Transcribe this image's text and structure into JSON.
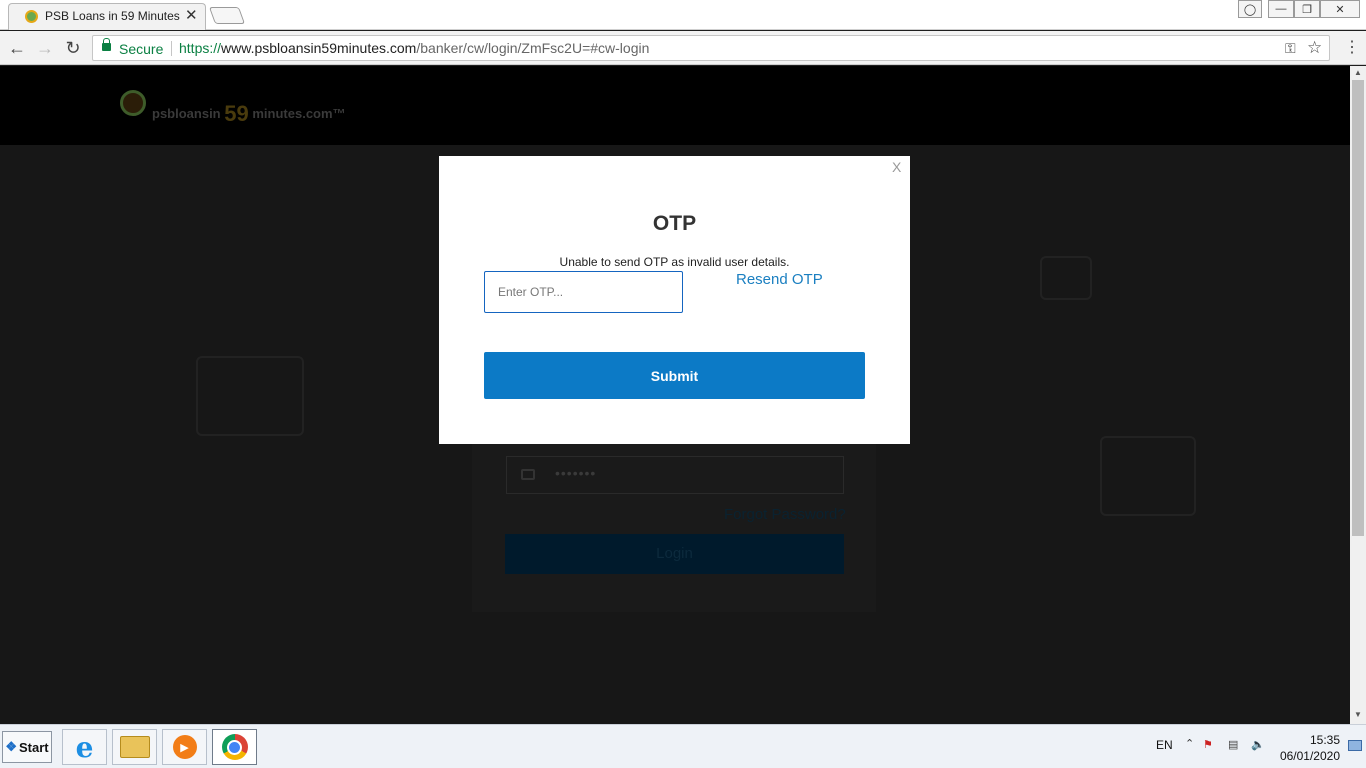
{
  "browser": {
    "tab_title": "PSB Loans in 59 Minutes",
    "tab_close": "✕",
    "secure_label": "Secure",
    "url_scheme": "https://",
    "url_host": "www.psbloansin59minutes.com",
    "url_path": "/banker/cw/login/ZmFsc2U=#cw-login"
  },
  "site": {
    "logo_small": "psbloansin",
    "logo_number": "59",
    "logo_suffix": "minutes.com™"
  },
  "login_form": {
    "password_mask": "•••••••",
    "forgot_link": "Forgot Password?",
    "login_button": "Login"
  },
  "modal": {
    "close_label": "X",
    "title": "OTP",
    "message": "Unable to send OTP as invalid user details.",
    "otp_placeholder": "Enter OTP...",
    "otp_value": "",
    "resend_link": "Resend OTP",
    "submit_label": "Submit"
  },
  "taskbar": {
    "start_label": "Start",
    "language": "EN",
    "time": "15:35",
    "date": "06/01/2020",
    "icons": [
      "internet-explorer-icon",
      "file-explorer-icon",
      "media-player-icon",
      "chrome-icon"
    ]
  },
  "colors": {
    "submit_bg": "#0c7ac6",
    "resend_link": "#1a7fc1",
    "secure_green": "#0b8043",
    "input_border": "#1565c0"
  }
}
